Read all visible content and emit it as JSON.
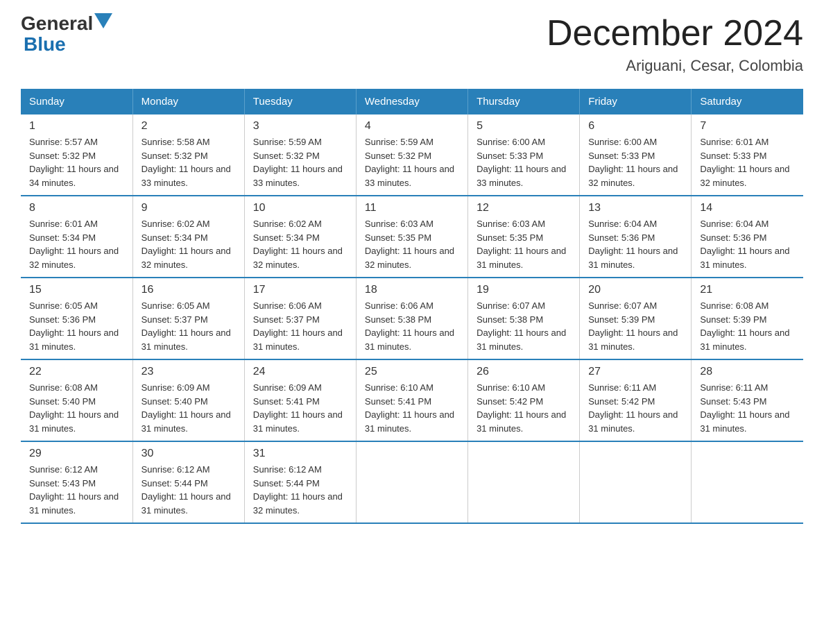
{
  "logo": {
    "general_text": "General",
    "blue_text": "Blue"
  },
  "title": {
    "month_year": "December 2024",
    "location": "Ariguani, Cesar, Colombia"
  },
  "calendar": {
    "headers": [
      "Sunday",
      "Monday",
      "Tuesday",
      "Wednesday",
      "Thursday",
      "Friday",
      "Saturday"
    ],
    "weeks": [
      [
        {
          "day": "1",
          "sunrise": "5:57 AM",
          "sunset": "5:32 PM",
          "daylight": "11 hours and 34 minutes."
        },
        {
          "day": "2",
          "sunrise": "5:58 AM",
          "sunset": "5:32 PM",
          "daylight": "11 hours and 33 minutes."
        },
        {
          "day": "3",
          "sunrise": "5:59 AM",
          "sunset": "5:32 PM",
          "daylight": "11 hours and 33 minutes."
        },
        {
          "day": "4",
          "sunrise": "5:59 AM",
          "sunset": "5:32 PM",
          "daylight": "11 hours and 33 minutes."
        },
        {
          "day": "5",
          "sunrise": "6:00 AM",
          "sunset": "5:33 PM",
          "daylight": "11 hours and 33 minutes."
        },
        {
          "day": "6",
          "sunrise": "6:00 AM",
          "sunset": "5:33 PM",
          "daylight": "11 hours and 32 minutes."
        },
        {
          "day": "7",
          "sunrise": "6:01 AM",
          "sunset": "5:33 PM",
          "daylight": "11 hours and 32 minutes."
        }
      ],
      [
        {
          "day": "8",
          "sunrise": "6:01 AM",
          "sunset": "5:34 PM",
          "daylight": "11 hours and 32 minutes."
        },
        {
          "day": "9",
          "sunrise": "6:02 AM",
          "sunset": "5:34 PM",
          "daylight": "11 hours and 32 minutes."
        },
        {
          "day": "10",
          "sunrise": "6:02 AM",
          "sunset": "5:34 PM",
          "daylight": "11 hours and 32 minutes."
        },
        {
          "day": "11",
          "sunrise": "6:03 AM",
          "sunset": "5:35 PM",
          "daylight": "11 hours and 32 minutes."
        },
        {
          "day": "12",
          "sunrise": "6:03 AM",
          "sunset": "5:35 PM",
          "daylight": "11 hours and 31 minutes."
        },
        {
          "day": "13",
          "sunrise": "6:04 AM",
          "sunset": "5:36 PM",
          "daylight": "11 hours and 31 minutes."
        },
        {
          "day": "14",
          "sunrise": "6:04 AM",
          "sunset": "5:36 PM",
          "daylight": "11 hours and 31 minutes."
        }
      ],
      [
        {
          "day": "15",
          "sunrise": "6:05 AM",
          "sunset": "5:36 PM",
          "daylight": "11 hours and 31 minutes."
        },
        {
          "day": "16",
          "sunrise": "6:05 AM",
          "sunset": "5:37 PM",
          "daylight": "11 hours and 31 minutes."
        },
        {
          "day": "17",
          "sunrise": "6:06 AM",
          "sunset": "5:37 PM",
          "daylight": "11 hours and 31 minutes."
        },
        {
          "day": "18",
          "sunrise": "6:06 AM",
          "sunset": "5:38 PM",
          "daylight": "11 hours and 31 minutes."
        },
        {
          "day": "19",
          "sunrise": "6:07 AM",
          "sunset": "5:38 PM",
          "daylight": "11 hours and 31 minutes."
        },
        {
          "day": "20",
          "sunrise": "6:07 AM",
          "sunset": "5:39 PM",
          "daylight": "11 hours and 31 minutes."
        },
        {
          "day": "21",
          "sunrise": "6:08 AM",
          "sunset": "5:39 PM",
          "daylight": "11 hours and 31 minutes."
        }
      ],
      [
        {
          "day": "22",
          "sunrise": "6:08 AM",
          "sunset": "5:40 PM",
          "daylight": "11 hours and 31 minutes."
        },
        {
          "day": "23",
          "sunrise": "6:09 AM",
          "sunset": "5:40 PM",
          "daylight": "11 hours and 31 minutes."
        },
        {
          "day": "24",
          "sunrise": "6:09 AM",
          "sunset": "5:41 PM",
          "daylight": "11 hours and 31 minutes."
        },
        {
          "day": "25",
          "sunrise": "6:10 AM",
          "sunset": "5:41 PM",
          "daylight": "11 hours and 31 minutes."
        },
        {
          "day": "26",
          "sunrise": "6:10 AM",
          "sunset": "5:42 PM",
          "daylight": "11 hours and 31 minutes."
        },
        {
          "day": "27",
          "sunrise": "6:11 AM",
          "sunset": "5:42 PM",
          "daylight": "11 hours and 31 minutes."
        },
        {
          "day": "28",
          "sunrise": "6:11 AM",
          "sunset": "5:43 PM",
          "daylight": "11 hours and 31 minutes."
        }
      ],
      [
        {
          "day": "29",
          "sunrise": "6:12 AM",
          "sunset": "5:43 PM",
          "daylight": "11 hours and 31 minutes."
        },
        {
          "day": "30",
          "sunrise": "6:12 AM",
          "sunset": "5:44 PM",
          "daylight": "11 hours and 31 minutes."
        },
        {
          "day": "31",
          "sunrise": "6:12 AM",
          "sunset": "5:44 PM",
          "daylight": "11 hours and 32 minutes."
        },
        null,
        null,
        null,
        null
      ]
    ]
  }
}
